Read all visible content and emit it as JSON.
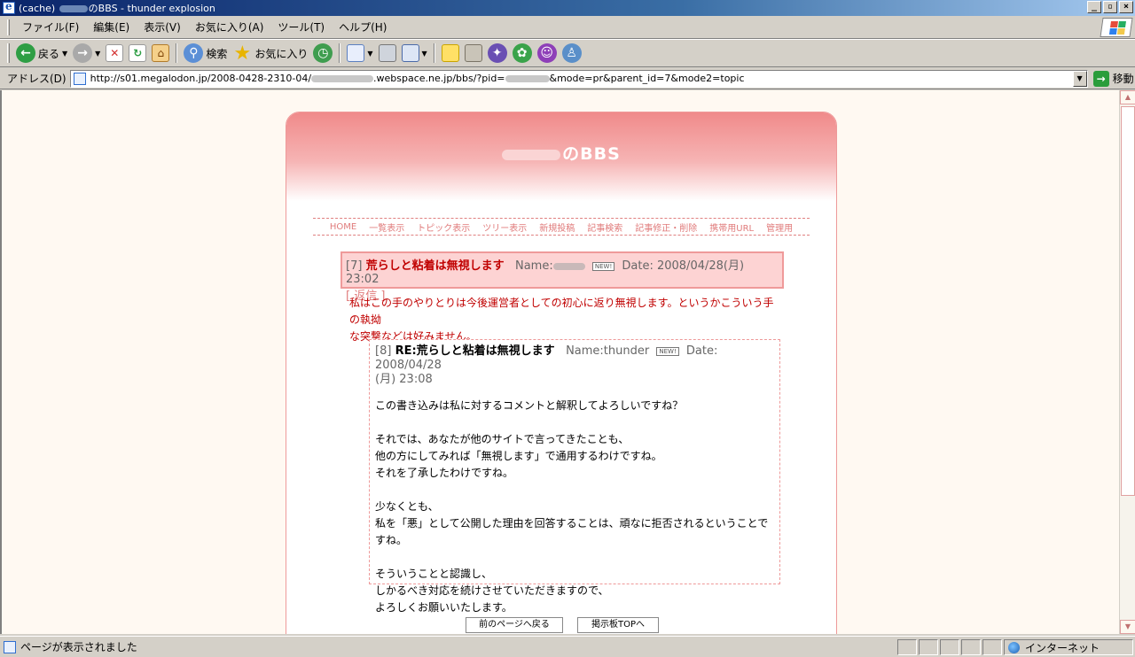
{
  "window": {
    "title_prefix": "(cache)",
    "title_suffix": "のBBS - thunder explosion",
    "controls": [
      "_",
      "▫",
      "×"
    ]
  },
  "menubar": {
    "items": [
      "ファイル(F)",
      "編集(E)",
      "表示(V)",
      "お気に入り(A)",
      "ツール(T)",
      "ヘルプ(H)"
    ]
  },
  "toolbar": {
    "back_label": "戻る",
    "search_label": "検索",
    "favorites_label": "お気に入り"
  },
  "addressbar": {
    "label": "アドレス(D)",
    "url_part1": "http://s01.megalodon.jp/2008-0428-2310-04/",
    "url_part2": ".webspace.ne.jp/bbs/?pid=",
    "url_part3": "&mode=pr&parent_id=7&mode2=topic",
    "go_label": "移動"
  },
  "board": {
    "title_suffix": "のBBS",
    "nav": [
      "HOME",
      "一覧表示",
      "トピック表示",
      "ツリー表示",
      "新規投稿",
      "記事検索",
      "記事修正・削除",
      "携帯用URL",
      "管理用"
    ]
  },
  "post": {
    "number": "[7]",
    "subject": "荒らしと粘着は無視します",
    "name_label": "Name:",
    "new_badge": "NEW!",
    "date": "Date: 2008/04/28(月) 23:02",
    "reply_link": "[ 返信 ]",
    "body_line1": "私はこの手のやりとりは今後運営者としての初心に返り無視します。というかこういう手の執拗",
    "body_line2": "な突撃などは好みません。"
  },
  "reply": {
    "number": "[8]",
    "subject": "RE:荒らしと粘着は無視します",
    "name": "Name:thunder",
    "new_badge": "NEW!",
    "date": "Date: 2008/04/28",
    "date_cont": "(月) 23:08",
    "body": "この書き込みは私に対するコメントと解釈してよろしいですね？\n\nそれでは、あなたが他のサイトで言ってきたことも、\n他の方にしてみれば「無視します」で通用するわけですね。\nそれを了承したわけですね。\n\n少なくとも、\n私を「悪」として公開した理由を回答することは、頑なに拒否されるということですね。\n\nそういうことと認識し、\nしかるべき対応を続けさせていただきますので、\nよろしくお願いいたします。"
  },
  "buttons": {
    "prev_page": "前のページへ戻る",
    "board_top": "掲示板TOPへ"
  },
  "statusbar": {
    "message": "ページが表示されました",
    "zone": "インターネット"
  },
  "colors": {
    "accent": "#e07b7b",
    "subject_red": "#c00000",
    "header_pink": "#f08a8a"
  }
}
